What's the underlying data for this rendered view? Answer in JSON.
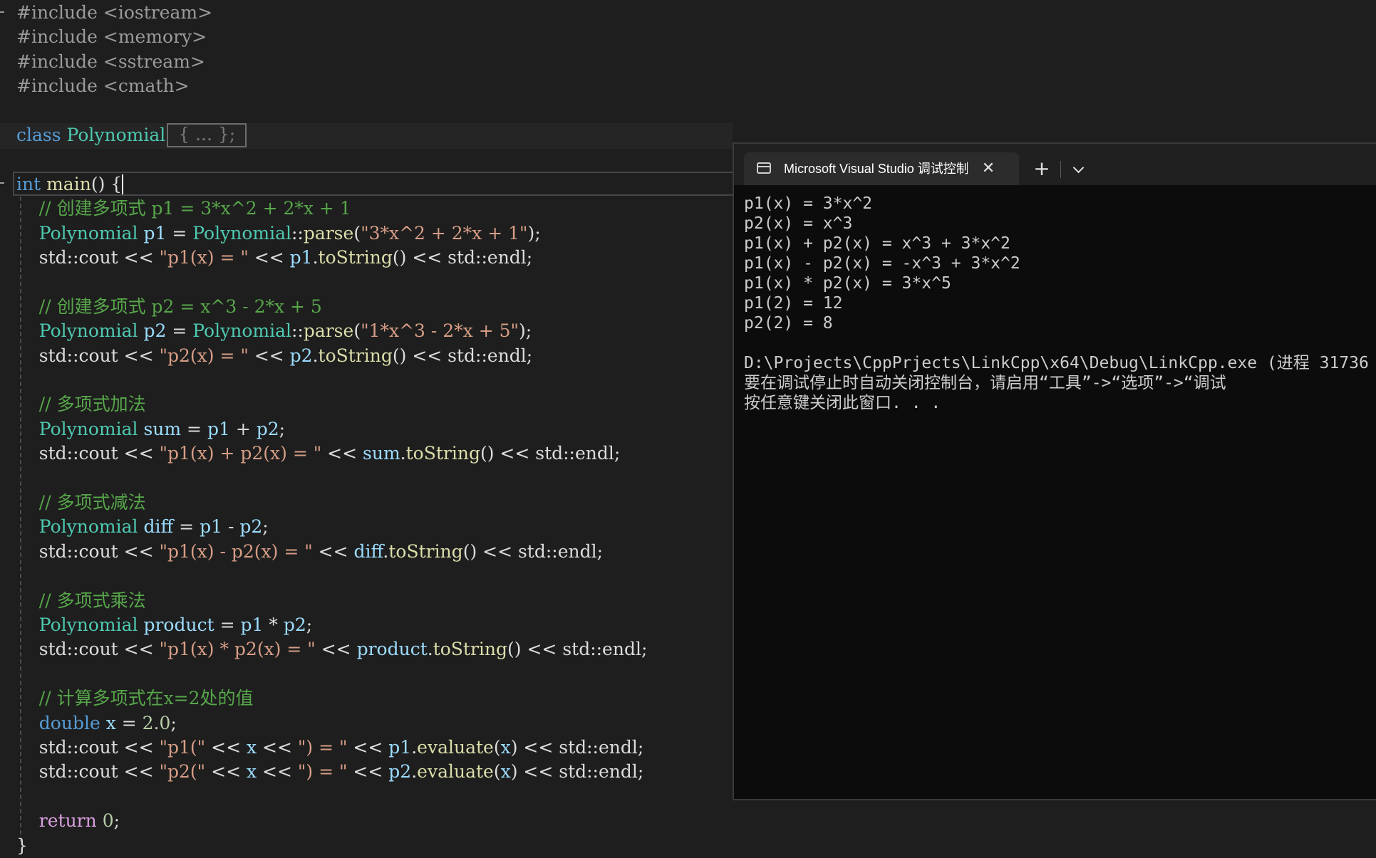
{
  "editor": {
    "lines": [
      {
        "parts": [
          {
            "c": "pp",
            "t": "#include <iostream>"
          }
        ]
      },
      {
        "parts": [
          {
            "c": "pp",
            "t": "#include <memory>"
          }
        ]
      },
      {
        "parts": [
          {
            "c": "pp",
            "t": "#include <sstream>"
          }
        ]
      },
      {
        "parts": [
          {
            "c": "pp",
            "t": "#include <cmath>"
          }
        ]
      },
      {
        "parts": []
      },
      {
        "parts": [
          {
            "c": "kw",
            "t": "class "
          },
          {
            "c": "ty",
            "t": "Polynomial"
          }
        ],
        "collapsed": "{ ... };"
      },
      {
        "parts": []
      },
      {
        "parts": [
          {
            "c": "kw",
            "t": "int "
          },
          {
            "c": "fn",
            "t": "main"
          },
          {
            "c": "txt",
            "t": "() {"
          }
        ],
        "caret": true
      },
      {
        "parts": [
          {
            "c": "cmt",
            "t": "    // 创建多项式 p1 = 3*x^2 + 2*x + 1"
          }
        ]
      },
      {
        "parts": [
          {
            "c": "ty",
            "t": "    Polynomial "
          },
          {
            "c": "var",
            "t": "p1"
          },
          {
            "c": "txt",
            "t": " = "
          },
          {
            "c": "ty",
            "t": "Polynomial"
          },
          {
            "c": "txt",
            "t": "::"
          },
          {
            "c": "fn",
            "t": "parse"
          },
          {
            "c": "txt",
            "t": "("
          },
          {
            "c": "str",
            "t": "\"3*x^2 + 2*x + 1\""
          },
          {
            "c": "txt",
            "t": ");"
          }
        ]
      },
      {
        "parts": [
          {
            "c": "txt",
            "t": "    std::cout << "
          },
          {
            "c": "str",
            "t": "\"p1(x) = \""
          },
          {
            "c": "txt",
            "t": " << "
          },
          {
            "c": "var",
            "t": "p1"
          },
          {
            "c": "txt",
            "t": "."
          },
          {
            "c": "fn",
            "t": "toString"
          },
          {
            "c": "txt",
            "t": "() << std::endl;"
          }
        ]
      },
      {
        "parts": []
      },
      {
        "parts": [
          {
            "c": "cmt",
            "t": "    // 创建多项式 p2 = x^3 - 2*x + 5"
          }
        ]
      },
      {
        "parts": [
          {
            "c": "ty",
            "t": "    Polynomial "
          },
          {
            "c": "var",
            "t": "p2"
          },
          {
            "c": "txt",
            "t": " = "
          },
          {
            "c": "ty",
            "t": "Polynomial"
          },
          {
            "c": "txt",
            "t": "::"
          },
          {
            "c": "fn",
            "t": "parse"
          },
          {
            "c": "txt",
            "t": "("
          },
          {
            "c": "str",
            "t": "\"1*x^3 - 2*x + 5\""
          },
          {
            "c": "txt",
            "t": ");"
          }
        ]
      },
      {
        "parts": [
          {
            "c": "txt",
            "t": "    std::cout << "
          },
          {
            "c": "str",
            "t": "\"p2(x) = \""
          },
          {
            "c": "txt",
            "t": " << "
          },
          {
            "c": "var",
            "t": "p2"
          },
          {
            "c": "txt",
            "t": "."
          },
          {
            "c": "fn",
            "t": "toString"
          },
          {
            "c": "txt",
            "t": "() << std::endl;"
          }
        ]
      },
      {
        "parts": []
      },
      {
        "parts": [
          {
            "c": "cmt",
            "t": "    // 多项式加法"
          }
        ]
      },
      {
        "parts": [
          {
            "c": "ty",
            "t": "    Polynomial "
          },
          {
            "c": "var",
            "t": "sum"
          },
          {
            "c": "txt",
            "t": " = "
          },
          {
            "c": "var",
            "t": "p1"
          },
          {
            "c": "txt",
            "t": " + "
          },
          {
            "c": "var",
            "t": "p2"
          },
          {
            "c": "txt",
            "t": ";"
          }
        ]
      },
      {
        "parts": [
          {
            "c": "txt",
            "t": "    std::cout << "
          },
          {
            "c": "str",
            "t": "\"p1(x) + p2(x) = \""
          },
          {
            "c": "txt",
            "t": " << "
          },
          {
            "c": "var",
            "t": "sum"
          },
          {
            "c": "txt",
            "t": "."
          },
          {
            "c": "fn",
            "t": "toString"
          },
          {
            "c": "txt",
            "t": "() << std::endl;"
          }
        ]
      },
      {
        "parts": []
      },
      {
        "parts": [
          {
            "c": "cmt",
            "t": "    // 多项式减法"
          }
        ]
      },
      {
        "parts": [
          {
            "c": "ty",
            "t": "    Polynomial "
          },
          {
            "c": "var",
            "t": "diff"
          },
          {
            "c": "txt",
            "t": " = "
          },
          {
            "c": "var",
            "t": "p1"
          },
          {
            "c": "txt",
            "t": " - "
          },
          {
            "c": "var",
            "t": "p2"
          },
          {
            "c": "txt",
            "t": ";"
          }
        ]
      },
      {
        "parts": [
          {
            "c": "txt",
            "t": "    std::cout << "
          },
          {
            "c": "str",
            "t": "\"p1(x) - p2(x) = \""
          },
          {
            "c": "txt",
            "t": " << "
          },
          {
            "c": "var",
            "t": "diff"
          },
          {
            "c": "txt",
            "t": "."
          },
          {
            "c": "fn",
            "t": "toString"
          },
          {
            "c": "txt",
            "t": "() << std::endl;"
          }
        ]
      },
      {
        "parts": []
      },
      {
        "parts": [
          {
            "c": "cmt",
            "t": "    // 多项式乘法"
          }
        ]
      },
      {
        "parts": [
          {
            "c": "ty",
            "t": "    Polynomial "
          },
          {
            "c": "var",
            "t": "product"
          },
          {
            "c": "txt",
            "t": " = "
          },
          {
            "c": "var",
            "t": "p1"
          },
          {
            "c": "txt",
            "t": " * "
          },
          {
            "c": "var",
            "t": "p2"
          },
          {
            "c": "txt",
            "t": ";"
          }
        ]
      },
      {
        "parts": [
          {
            "c": "txt",
            "t": "    std::cout << "
          },
          {
            "c": "str",
            "t": "\"p1(x) * p2(x) = \""
          },
          {
            "c": "txt",
            "t": " << "
          },
          {
            "c": "var",
            "t": "product"
          },
          {
            "c": "txt",
            "t": "."
          },
          {
            "c": "fn",
            "t": "toString"
          },
          {
            "c": "txt",
            "t": "() << std::endl;"
          }
        ]
      },
      {
        "parts": []
      },
      {
        "parts": [
          {
            "c": "cmt",
            "t": "    // 计算多项式在x=2处的值"
          }
        ]
      },
      {
        "parts": [
          {
            "c": "kw",
            "t": "    double "
          },
          {
            "c": "var",
            "t": "x"
          },
          {
            "c": "txt",
            "t": " = "
          },
          {
            "c": "num",
            "t": "2.0"
          },
          {
            "c": "txt",
            "t": ";"
          }
        ]
      },
      {
        "parts": [
          {
            "c": "txt",
            "t": "    std::cout << "
          },
          {
            "c": "str",
            "t": "\"p1(\""
          },
          {
            "c": "txt",
            "t": " << "
          },
          {
            "c": "var",
            "t": "x"
          },
          {
            "c": "txt",
            "t": " << "
          },
          {
            "c": "str",
            "t": "\") = \""
          },
          {
            "c": "txt",
            "t": " << "
          },
          {
            "c": "var",
            "t": "p1"
          },
          {
            "c": "txt",
            "t": "."
          },
          {
            "c": "fn",
            "t": "evaluate"
          },
          {
            "c": "txt",
            "t": "("
          },
          {
            "c": "var",
            "t": "x"
          },
          {
            "c": "txt",
            "t": ") << std::endl;"
          }
        ]
      },
      {
        "parts": [
          {
            "c": "txt",
            "t": "    std::cout << "
          },
          {
            "c": "str",
            "t": "\"p2(\""
          },
          {
            "c": "txt",
            "t": " << "
          },
          {
            "c": "var",
            "t": "x"
          },
          {
            "c": "txt",
            "t": " << "
          },
          {
            "c": "str",
            "t": "\") = \""
          },
          {
            "c": "txt",
            "t": " << "
          },
          {
            "c": "var",
            "t": "p2"
          },
          {
            "c": "txt",
            "t": "."
          },
          {
            "c": "fn",
            "t": "evaluate"
          },
          {
            "c": "txt",
            "t": "("
          },
          {
            "c": "var",
            "t": "x"
          },
          {
            "c": "txt",
            "t": ") << std::endl;"
          }
        ]
      },
      {
        "parts": []
      },
      {
        "parts": [
          {
            "c": "ret",
            "t": "    return "
          },
          {
            "c": "num",
            "t": "0"
          },
          {
            "c": "txt",
            "t": ";"
          }
        ]
      },
      {
        "parts": [
          {
            "c": "txt",
            "t": "}"
          }
        ]
      }
    ]
  },
  "console": {
    "tab_title": "Microsoft Visual Studio 调试控制台",
    "tab_icon": "console-app-icon",
    "close_glyph": "✕",
    "new_tab_glyph": "+",
    "output": [
      "p1(x) = 3*x^2",
      "p2(x) = x^3",
      "p1(x) + p2(x) = x^3 + 3*x^2",
      "p1(x) - p2(x) = -x^3 + 3*x^2",
      "p1(x) * p2(x) = 3*x^5",
      "p1(2) = 12",
      "p2(2) = 8",
      "",
      "D:\\Projects\\CppPrjects\\LinkCpp\\x64\\Debug\\LinkCpp.exe (进程 31736",
      "要在调试停止时自动关闭控制台，请启用“工具”->“选项”->“调试",
      "按任意键关闭此窗口. . ."
    ]
  },
  "colors": {
    "editor_bg": "#1e1e1e",
    "console_bg": "#0c0c0c",
    "keyword": "#569cd6",
    "type": "#4ec9b0",
    "function": "#dcdcaa",
    "variable": "#9cdcfe",
    "string": "#d69d85",
    "comment": "#57a64a"
  }
}
